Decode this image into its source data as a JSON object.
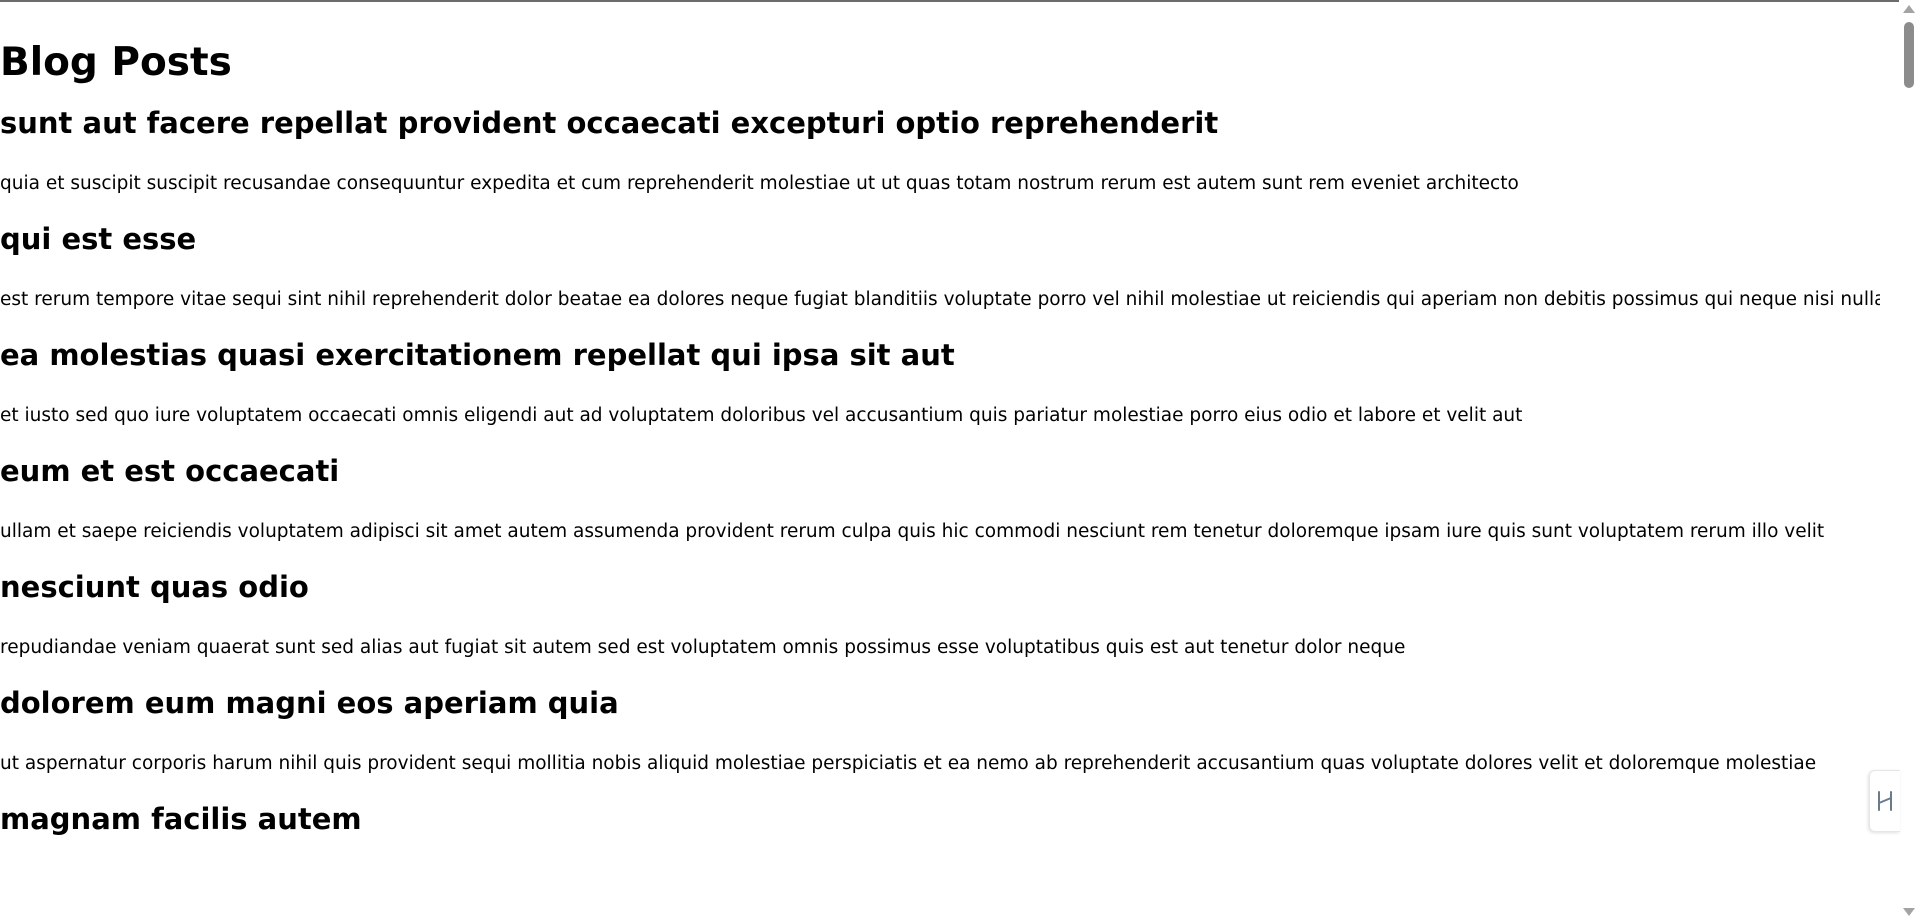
{
  "page": {
    "title": "Blog Posts"
  },
  "posts": [
    {
      "title": "sunt aut facere repellat provident occaecati excepturi optio reprehenderit",
      "body": "quia et suscipit suscipit recusandae consequuntur expedita et cum reprehenderit molestiae ut ut quas totam nostrum rerum est autem sunt rem eveniet architecto"
    },
    {
      "title": "qui est esse",
      "body": "est rerum tempore vitae sequi sint nihil reprehenderit dolor beatae ea dolores neque fugiat blanditiis voluptate porro vel nihil molestiae ut reiciendis qui aperiam non debitis possimus qui neque nisi nulla"
    },
    {
      "title": "ea molestias quasi exercitationem repellat qui ipsa sit aut",
      "body": "et iusto sed quo iure voluptatem occaecati omnis eligendi aut ad voluptatem doloribus vel accusantium quis pariatur molestiae porro eius odio et labore et velit aut"
    },
    {
      "title": "eum et est occaecati",
      "body": "ullam et saepe reiciendis voluptatem adipisci sit amet autem assumenda provident rerum culpa quis hic commodi nesciunt rem tenetur doloremque ipsam iure quis sunt voluptatem rerum illo velit"
    },
    {
      "title": "nesciunt quas odio",
      "body": "repudiandae veniam quaerat sunt sed alias aut fugiat sit autem sed est voluptatem omnis possimus esse voluptatibus quis est aut tenetur dolor neque"
    },
    {
      "title": "dolorem eum magni eos aperiam quia",
      "body": "ut aspernatur corporis harum nihil quis provident sequi mollitia nobis aliquid molestiae perspiciatis et ea nemo ab reprehenderit accusantium quas voluptate dolores velit et doloremque molestiae"
    },
    {
      "title": "magnam facilis autem",
      "body": ""
    }
  ],
  "icons": {
    "scroll_up": "scroll-up-arrow-icon",
    "scroll_down": "scroll-down-arrow-icon",
    "side_widget": "translate-icon"
  },
  "colors": {
    "text": "#000000",
    "background": "#ffffff",
    "scroll_thumb": "#8c8c8c"
  }
}
